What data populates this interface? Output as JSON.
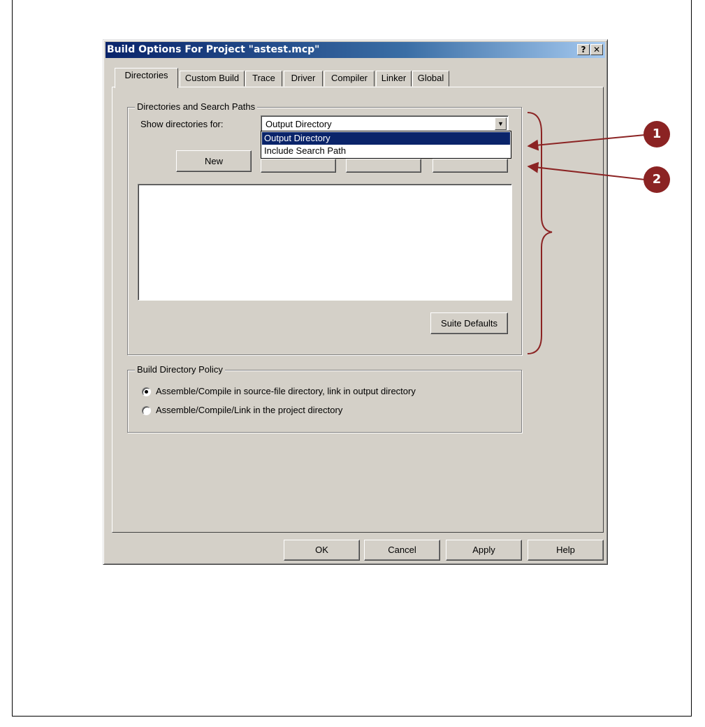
{
  "window": {
    "title": "Build Options For Project \"astest.mcp\"",
    "help_btn": "?",
    "close_btn": "✕"
  },
  "tabs": [
    "Directories",
    "Custom Build",
    "Trace",
    "Driver",
    "Compiler",
    "Linker",
    "Global"
  ],
  "active_tab": "Directories",
  "directories": {
    "group_label": "Directories and Search Paths",
    "show_label": "Show directories for:",
    "combo_value": "Output Directory",
    "options": [
      "Output Directory",
      "Include Search Path"
    ],
    "new_button": "New",
    "suite_defaults_button": "Suite Defaults"
  },
  "policy": {
    "group_label": "Build Directory Policy",
    "radio1": "Assemble/Compile in source-file directory, link in output directory",
    "radio2": "Assemble/Compile/Link in the project directory"
  },
  "footer": {
    "ok": "OK",
    "cancel": "Cancel",
    "apply": "Apply",
    "help": "Help"
  },
  "callouts": [
    "1",
    "2"
  ],
  "colors": {
    "callout": "#8b2323",
    "title_bar": "#0a246a",
    "dialog_bg": "#d4d0c8"
  }
}
